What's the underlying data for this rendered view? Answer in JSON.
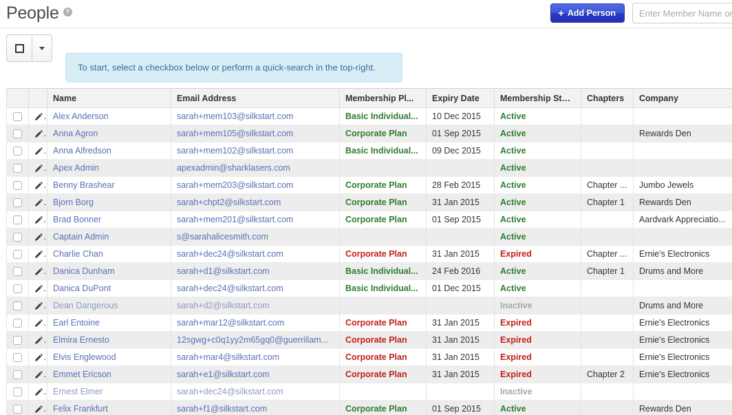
{
  "header": {
    "title": "People",
    "help_icon": "question-mark-icon",
    "add_person_label": "Add Person",
    "add_person_icon": "plus-icon",
    "search_placeholder": "Enter Member Name or"
  },
  "toolbar": {
    "bulk_select_icon": "checkbox-square-icon",
    "bulk_dropdown_icon": "caret-down-icon",
    "hint_text": "To start, select a checkbox below or perform a quick-search in the top-right."
  },
  "colors": {
    "accent": "#4059dd",
    "active": "#2f7d2f",
    "expired": "#c0211b",
    "inactive": "#a8a8a8",
    "link": "#5b6fb5",
    "alert_bg": "#d9edf7",
    "alert_text": "#3a6d9a"
  },
  "table": {
    "columns": [
      {
        "key": "check",
        "label": ""
      },
      {
        "key": "edit",
        "label": ""
      },
      {
        "key": "name",
        "label": "Name"
      },
      {
        "key": "email",
        "label": "Email Address"
      },
      {
        "key": "plan",
        "label": "Membership Pl..."
      },
      {
        "key": "expiry",
        "label": "Expiry Date"
      },
      {
        "key": "status",
        "label": "Membership Stat..."
      },
      {
        "key": "chapter",
        "label": "Chapters"
      },
      {
        "key": "company",
        "label": "Company"
      }
    ],
    "rows": [
      {
        "name": "Alex Anderson",
        "email": "sarah+mem103@silkstart.com",
        "plan": "Basic Individual...",
        "plan_state": "active",
        "expiry": "10 Dec 2015",
        "status": "Active",
        "status_state": "active",
        "chapter": "",
        "company": ""
      },
      {
        "name": "Anna Agron",
        "email": "sarah+mem105@silkstart.com",
        "plan": "Corporate Plan",
        "plan_state": "active",
        "expiry": "01 Sep 2015",
        "status": "Active",
        "status_state": "active",
        "chapter": "",
        "company": "Rewards Den"
      },
      {
        "name": "Anna Alfredson",
        "email": "sarah+mem102@silkstart.com",
        "plan": "Basic Individual...",
        "plan_state": "active",
        "expiry": "09 Dec 2015",
        "status": "Active",
        "status_state": "active",
        "chapter": "",
        "company": ""
      },
      {
        "name": "Apex Admin",
        "email": "apexadmin@sharklasers.com",
        "plan": "",
        "plan_state": "none",
        "expiry": "",
        "status": "Active",
        "status_state": "active",
        "chapter": "",
        "company": ""
      },
      {
        "name": "Benny Brashear",
        "email": "sarah+mem203@silkstart.com",
        "plan": "Corporate Plan",
        "plan_state": "active",
        "expiry": "28 Feb 2015",
        "status": "Active",
        "status_state": "active",
        "chapter": "Chapter ...",
        "company": "Jumbo Jewels"
      },
      {
        "name": "Bjorn Borg",
        "email": "sarah+chpt2@silkstart.com",
        "plan": "Corporate Plan",
        "plan_state": "active",
        "expiry": "31 Jan 2015",
        "status": "Active",
        "status_state": "active",
        "chapter": "Chapter 1",
        "company": "Rewards Den"
      },
      {
        "name": "Brad Bonner",
        "email": "sarah+mem201@silkstart.com",
        "plan": "Corporate Plan",
        "plan_state": "active",
        "expiry": "01 Sep 2015",
        "status": "Active",
        "status_state": "active",
        "chapter": "",
        "company": "Aardvark Appreciatio..."
      },
      {
        "name": "Captain Admin",
        "email": "s@sarahalicesmith.com",
        "plan": "",
        "plan_state": "none",
        "expiry": "",
        "status": "Active",
        "status_state": "active",
        "chapter": "",
        "company": ""
      },
      {
        "name": "Charlie Chan",
        "email": "sarah+dec24@silkstart.com",
        "plan": "Corporate Plan",
        "plan_state": "expired",
        "expiry": "31 Jan 2015",
        "status": "Expired",
        "status_state": "expired",
        "chapter": "Chapter ...",
        "company": "Ernie's Electronics"
      },
      {
        "name": "Danica Dunham",
        "email": "sarah+d1@silkstart.com",
        "plan": "Basic Individual...",
        "plan_state": "active",
        "expiry": "24 Feb 2016",
        "status": "Active",
        "status_state": "active",
        "chapter": "Chapter 1",
        "company": "Drums and More"
      },
      {
        "name": "Danica DuPont",
        "email": "sarah+dec24@silkstart.com",
        "plan": "Basic Individual...",
        "plan_state": "active",
        "expiry": "01 Dec 2015",
        "status": "Active",
        "status_state": "active",
        "chapter": "",
        "company": ""
      },
      {
        "name": "Dean Dangerous",
        "email": "sarah+d2@silkstart.com",
        "plan": "",
        "plan_state": "none",
        "expiry": "",
        "status": "Inactive",
        "status_state": "inactive",
        "chapter": "",
        "company": "Drums and More",
        "muted": true
      },
      {
        "name": "Earl Entoine",
        "email": "sarah+mar12@silkstart.com",
        "plan": "Corporate Plan",
        "plan_state": "expired",
        "expiry": "31 Jan 2015",
        "status": "Expired",
        "status_state": "expired",
        "chapter": "",
        "company": "Ernie's Electronics"
      },
      {
        "name": "Elmira Ernesto",
        "email": "12sgwg+c0q1yy2m65gq0@guerrillam...",
        "plan": "Corporate Plan",
        "plan_state": "expired",
        "expiry": "31 Jan 2015",
        "status": "Expired",
        "status_state": "expired",
        "chapter": "",
        "company": "Ernie's Electronics"
      },
      {
        "name": "Elvis Englewood",
        "email": "sarah+mar4@silkstart.com",
        "plan": "Corporate Plan",
        "plan_state": "expired",
        "expiry": "31 Jan 2015",
        "status": "Expired",
        "status_state": "expired",
        "chapter": "",
        "company": "Ernie's Electronics"
      },
      {
        "name": "Emmet Ericson",
        "email": "sarah+e1@silkstart.com",
        "plan": "Corporate Plan",
        "plan_state": "expired",
        "expiry": "31 Jan 2015",
        "status": "Expired",
        "status_state": "expired",
        "chapter": "Chapter 2",
        "company": "Ernie's Electronics"
      },
      {
        "name": "Ernest Elmer",
        "email": "sarah+dec24@silkstart.com",
        "plan": "",
        "plan_state": "none",
        "expiry": "",
        "status": "Inactive",
        "status_state": "inactive",
        "chapter": "",
        "company": "",
        "muted": true
      },
      {
        "name": "Felix Frankfurt",
        "email": "sarah+f1@silkstart.com",
        "plan": "Corporate Plan",
        "plan_state": "active",
        "expiry": "01 Sep 2015",
        "status": "Active",
        "status_state": "active",
        "chapter": "",
        "company": "Rewards Den"
      }
    ]
  }
}
